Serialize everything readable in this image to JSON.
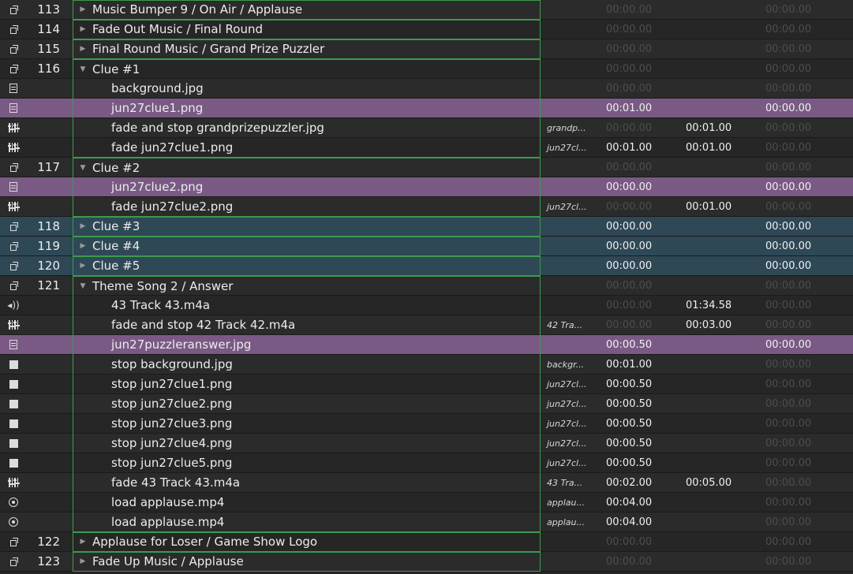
{
  "icons": {
    "group": "group-icon",
    "video": "video-icon",
    "fade": "fade-icon",
    "audio": "speaker-icon",
    "stop": "stop-icon",
    "load": "load-icon"
  },
  "colors": {
    "background": "#242424",
    "selected_purple": "#7a5a85",
    "selected_blue": "#2f4856",
    "group_outline_green": "#3b9b4e"
  },
  "rows": [
    {
      "icon": "group",
      "number": "113",
      "name": "Music Bumper 9 / On Air / Applause",
      "target": "",
      "pre": "00:00.00",
      "action": "",
      "post": "00:00.00",
      "level": 0,
      "disclosure": "collapsed"
    },
    {
      "icon": "group",
      "number": "114",
      "name": "Fade Out Music / Final Round",
      "target": "",
      "pre": "00:00.00",
      "action": "",
      "post": "00:00.00",
      "level": 0,
      "disclosure": "collapsed"
    },
    {
      "icon": "group",
      "number": "115",
      "name": "Final Round Music / Grand Prize Puzzler",
      "target": "",
      "pre": "00:00.00",
      "action": "",
      "post": "00:00.00",
      "level": 0,
      "disclosure": "collapsed"
    },
    {
      "icon": "group",
      "number": "116",
      "name": "Clue #1",
      "target": "",
      "pre": "00:00.00",
      "action": "",
      "post": "00:00.00",
      "level": 0,
      "disclosure": "expanded"
    },
    {
      "icon": "video",
      "number": "",
      "name": "background.jpg",
      "target": "",
      "pre": "00:00.00",
      "action": "",
      "post": "00:00.00",
      "level": 1
    },
    {
      "icon": "video",
      "number": "",
      "name": "jun27clue1.png",
      "target": "",
      "pre": "00:01.00",
      "action": "",
      "post": "00:00.00",
      "level": 1,
      "highlight": "purple"
    },
    {
      "icon": "fade",
      "number": "",
      "name": "fade and stop grandprizepuzzler.jpg",
      "target": "grandp...",
      "pre": "00:00.00",
      "action": "00:01.00",
      "post": "00:00.00",
      "level": 1
    },
    {
      "icon": "fade",
      "number": "",
      "name": "fade jun27clue1.png",
      "target": "jun27cl...",
      "pre": "00:01.00",
      "action": "00:01.00",
      "post": "00:00.00",
      "level": 1
    },
    {
      "icon": "group",
      "number": "117",
      "name": "Clue #2",
      "target": "",
      "pre": "00:00.00",
      "action": "",
      "post": "00:00.00",
      "level": 0,
      "disclosure": "expanded"
    },
    {
      "icon": "video",
      "number": "",
      "name": "jun27clue2.png",
      "target": "",
      "pre": "00:00.00",
      "action": "",
      "post": "00:00.00",
      "level": 1,
      "highlight": "purple"
    },
    {
      "icon": "fade",
      "number": "",
      "name": "fade jun27clue2.png",
      "target": "jun27cl...",
      "pre": "00:00.00",
      "action": "00:01.00",
      "post": "00:00.00",
      "level": 1
    },
    {
      "icon": "group",
      "number": "118",
      "name": "Clue #3",
      "target": "",
      "pre": "00:00.00",
      "action": "",
      "post": "00:00.00",
      "level": 0,
      "disclosure": "collapsed",
      "highlight": "blue"
    },
    {
      "icon": "group",
      "number": "119",
      "name": "Clue #4",
      "target": "",
      "pre": "00:00.00",
      "action": "",
      "post": "00:00.00",
      "level": 0,
      "disclosure": "collapsed",
      "highlight": "blue"
    },
    {
      "icon": "group",
      "number": "120",
      "name": "Clue #5",
      "target": "",
      "pre": "00:00.00",
      "action": "",
      "post": "00:00.00",
      "level": 0,
      "disclosure": "collapsed",
      "highlight": "blue"
    },
    {
      "icon": "group",
      "number": "121",
      "name": "Theme Song 2 / Answer",
      "target": "",
      "pre": "00:00.00",
      "action": "",
      "post": "00:00.00",
      "level": 0,
      "disclosure": "expanded"
    },
    {
      "icon": "audio",
      "number": "",
      "name": "43 Track 43.m4a",
      "target": "",
      "pre": "00:00.00",
      "action": "01:34.58",
      "post": "00:00.00",
      "level": 1
    },
    {
      "icon": "fade",
      "number": "",
      "name": "fade and stop 42 Track 42.m4a",
      "target": "42 Tra...",
      "pre": "00:00.00",
      "action": "00:03.00",
      "post": "00:00.00",
      "level": 1
    },
    {
      "icon": "video",
      "number": "",
      "name": "jun27puzzleranswer.jpg",
      "target": "",
      "pre": "00:00.50",
      "action": "",
      "post": "00:00.00",
      "level": 1,
      "highlight": "purple"
    },
    {
      "icon": "stop",
      "number": "",
      "name": "stop background.jpg",
      "target": "backgr...",
      "pre": "00:01.00",
      "action": "",
      "post": "00:00.00",
      "level": 1
    },
    {
      "icon": "stop",
      "number": "",
      "name": "stop jun27clue1.png",
      "target": "jun27cl...",
      "pre": "00:00.50",
      "action": "",
      "post": "00:00.00",
      "level": 1
    },
    {
      "icon": "stop",
      "number": "",
      "name": "stop jun27clue2.png",
      "target": "jun27cl...",
      "pre": "00:00.50",
      "action": "",
      "post": "00:00.00",
      "level": 1
    },
    {
      "icon": "stop",
      "number": "",
      "name": "stop jun27clue3.png",
      "target": "jun27cl...",
      "pre": "00:00.50",
      "action": "",
      "post": "00:00.00",
      "level": 1
    },
    {
      "icon": "stop",
      "number": "",
      "name": "stop jun27clue4.png",
      "target": "jun27cl...",
      "pre": "00:00.50",
      "action": "",
      "post": "00:00.00",
      "level": 1
    },
    {
      "icon": "stop",
      "number": "",
      "name": "stop jun27clue5.png",
      "target": "jun27cl...",
      "pre": "00:00.50",
      "action": "",
      "post": "00:00.00",
      "level": 1
    },
    {
      "icon": "fade",
      "number": "",
      "name": "fade 43 Track 43.m4a",
      "target": "43 Tra...",
      "pre": "00:02.00",
      "action": "00:05.00",
      "post": "00:00.00",
      "level": 1
    },
    {
      "icon": "load",
      "number": "",
      "name": "load applause.mp4",
      "target": "applau...",
      "pre": "00:04.00",
      "action": "",
      "post": "00:00.00",
      "level": 1
    },
    {
      "icon": "load",
      "number": "",
      "name": "load applause.mp4",
      "target": "applau...",
      "pre": "00:04.00",
      "action": "",
      "post": "00:00.00",
      "level": 1
    },
    {
      "icon": "group",
      "number": "122",
      "name": "Applause for Loser / Game Show Logo",
      "target": "",
      "pre": "00:00.00",
      "action": "",
      "post": "00:00.00",
      "level": 0,
      "disclosure": "collapsed"
    },
    {
      "icon": "group",
      "number": "123",
      "name": "Fade Up Music / Applause",
      "target": "",
      "pre": "00:00.00",
      "action": "",
      "post": "00:00.00",
      "level": 0,
      "disclosure": "collapsed"
    }
  ]
}
